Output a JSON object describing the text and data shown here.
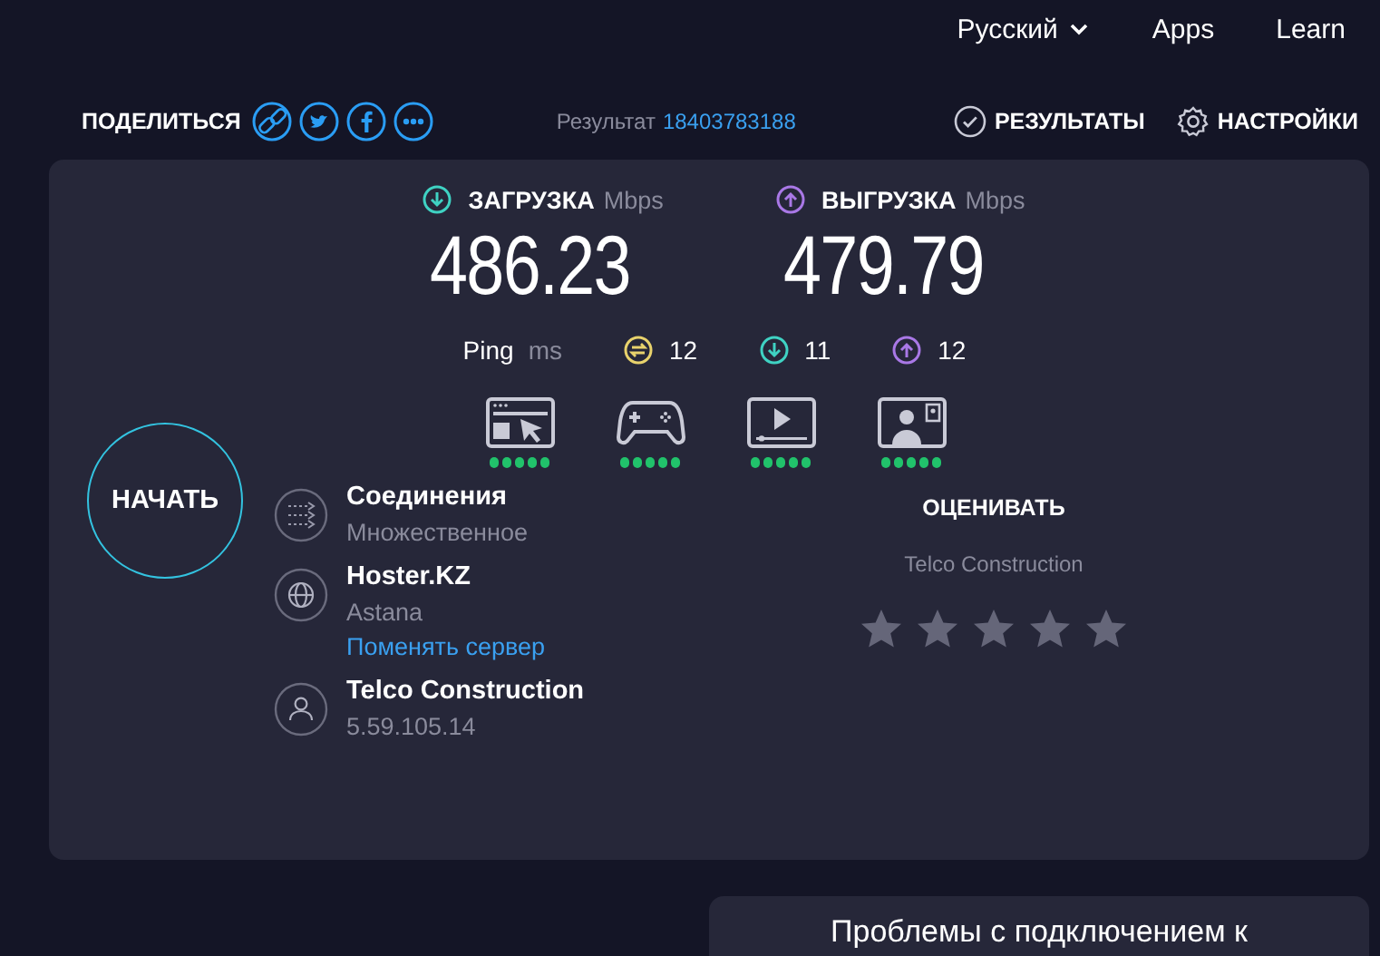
{
  "nav": {
    "language": "Русский",
    "links": [
      "Apps",
      "Learn"
    ]
  },
  "share": {
    "label": "ПОДЕЛИТЬСЯ"
  },
  "result": {
    "label": "Результат",
    "id": "18403783188"
  },
  "actions": [
    {
      "kind": "results",
      "label": "РЕЗУЛЬТАТЫ"
    },
    {
      "kind": "settings",
      "label": "НАСТРОЙКИ"
    }
  ],
  "speeds": [
    {
      "kind": "download",
      "label": "ЗАГРУЗКА",
      "unit": "Mbps",
      "value": "486.23"
    },
    {
      "kind": "upload",
      "label": "ВЫГРУЗКА",
      "unit": "Mbps",
      "value": "479.79"
    }
  ],
  "ping": {
    "label": "Ping",
    "unit": "ms",
    "values": [
      {
        "kind": "idle",
        "value": "12"
      },
      {
        "kind": "download",
        "value": "11"
      },
      {
        "kind": "upload",
        "value": "12"
      }
    ]
  },
  "activities": [
    {
      "kind": "browsing",
      "stars": 5
    },
    {
      "kind": "gaming",
      "stars": 5
    },
    {
      "kind": "streaming",
      "stars": 5
    },
    {
      "kind": "video-call",
      "stars": 5
    }
  ],
  "start_button": "НАЧАТЬ",
  "details": [
    {
      "kind": "connections",
      "title": "Соединения",
      "subtitle": "Множественное"
    },
    {
      "kind": "server",
      "title": "Hoster.KZ",
      "subtitle": "Astana",
      "link": "Поменять сервер"
    },
    {
      "kind": "provider",
      "title": "Telco Construction",
      "subtitle": "5.59.105.14"
    }
  ],
  "rating": {
    "title": "ОЦЕНИВАТЬ",
    "provider": "Telco Construction",
    "stars": 0
  },
  "bottom_card": {
    "title": "Проблемы с подключением к"
  }
}
